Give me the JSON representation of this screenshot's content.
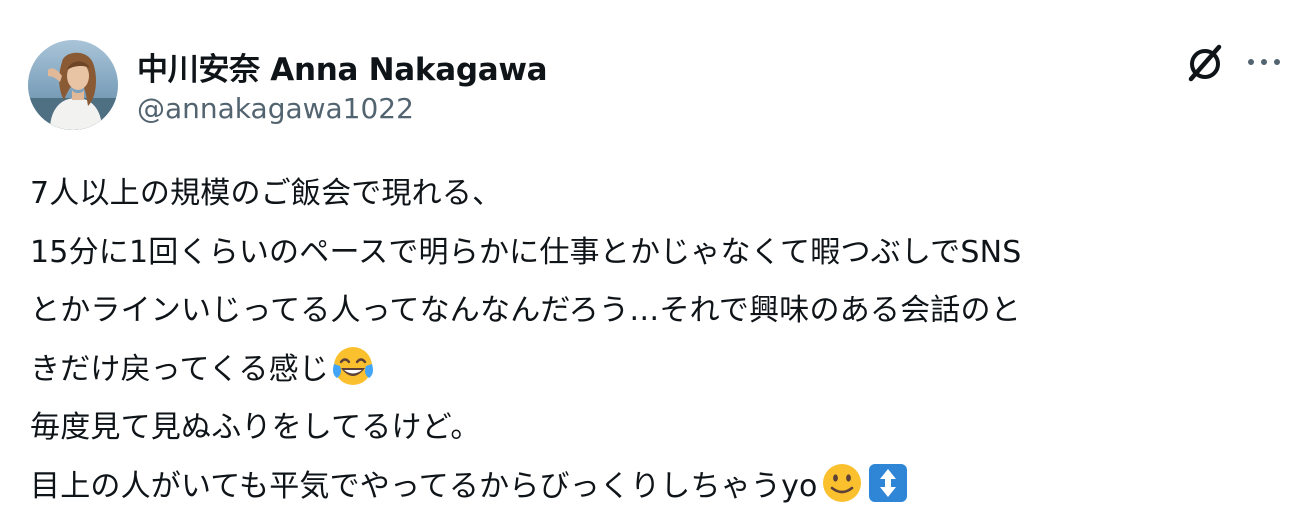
{
  "author": {
    "display_name": "中川安奈 Anna Nakagawa",
    "handle": "@annakagawa1022"
  },
  "header_icons": [
    "grok-icon",
    "more-options-icon"
  ],
  "tweet": {
    "lines": [
      "7人以上の規模のご飯会で現れる、",
      "15分に1回くらいのペースで明らかに仕事とかじゃなくて暇つぶしでSNS",
      "とかラインいじってる人ってなんなんだろう…それで興味のある会話のと",
      "きだけ戻ってくる感じ",
      "毎度見て見ぬふりをしてるけど。",
      "目上の人がいても平気でやってるからびっくりしちゃうyo"
    ],
    "emoji": [
      "face-with-tears-of-joy-emoji",
      "slightly-smiling-face-emoji",
      "up-down-arrow-emoji"
    ]
  },
  "colors": {
    "text": "#0f1419",
    "secondary": "#536471",
    "background": "#ffffff",
    "emoji_yellow": "#fbc02d",
    "emoji_tear_blue": "#42a5f5",
    "arrow_box_blue": "#2f86d6"
  }
}
